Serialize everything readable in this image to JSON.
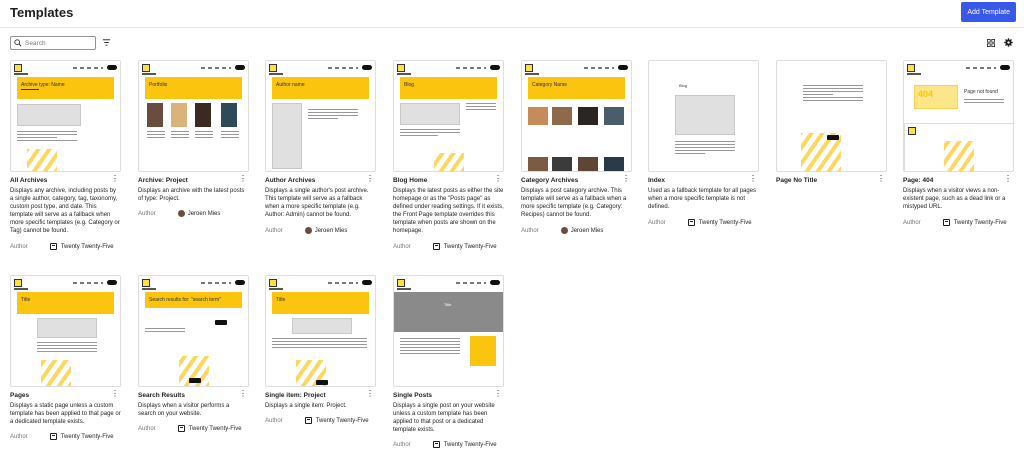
{
  "header": {
    "title": "Templates",
    "add_button": "Add Template"
  },
  "toolbar": {
    "search_placeholder": "Search"
  },
  "icons": {
    "search": "search-icon",
    "filter": "filter-icon",
    "view": "grid-view-icon",
    "settings": "gear-icon",
    "more": "more-vertical-icon",
    "theme": "layout-icon"
  },
  "colors": {
    "accent": "#3858e9",
    "theme_yellow": "#fbc40e"
  },
  "templates": [
    {
      "title": "All Archives",
      "description": "Displays any archive, including posts by a single author, category, tag, taxonomy, custom post type, and date. This template will serve as a fallback when more specific templates (e.g. Category or Tag) cannot be found.",
      "author_label": "Author",
      "author": "Twenty Twenty-Five",
      "thumb_title": "Archive type: Name"
    },
    {
      "title": "Archive: Project",
      "description": "Displays an archive with the latest posts of type: Project.",
      "author_label": "Author",
      "author": "Jeroen Mies",
      "thumb_title": "Portfolio"
    },
    {
      "title": "Author Archives",
      "description": "Displays a single author's post archive. This template will serve as a fallback when a more specific template (e.g. Author: Admin) cannot be found.",
      "author_label": "Author",
      "author": "Jeroen Mies",
      "thumb_title": "Author name"
    },
    {
      "title": "Blog Home",
      "description": "Displays the latest posts as either the site homepage or as the \"Posts page\" as defined under reading settings. If it exists, the Front Page template overrides this template when posts are shown on the homepage.",
      "author_label": "Author",
      "author": "Twenty Twenty-Five",
      "thumb_title": "Blog"
    },
    {
      "title": "Category Archives",
      "description": "Displays a post category archive. This template will serve as a fallback when a more specific template (e.g. Category: Recipes) cannot be found.",
      "author_label": "Author",
      "author": "Jeroen Mies",
      "thumb_title": "Category Name"
    },
    {
      "title": "Index",
      "description": "Used as a fallback template for all pages when a more specific template is not defined.",
      "author_label": "Author",
      "author": "Twenty Twenty-Five",
      "thumb_title": "Blog"
    },
    {
      "title": "Page No Title",
      "description": "",
      "author_label": "",
      "author": "",
      "thumb_title": ""
    },
    {
      "title": "Page: 404",
      "description": "Displays when a visitor views a non-existent page, such as a dead link or a mistyped URL.",
      "author_label": "Author",
      "author": "Twenty Twenty-Five",
      "thumb_title": "Page not found"
    },
    {
      "title": "Pages",
      "description": "Displays a static page unless a custom template has been applied to that page or a dedicated template exists.",
      "author_label": "Author",
      "author": "Twenty Twenty-Five",
      "thumb_title": "Title"
    },
    {
      "title": "Search Results",
      "description": "Displays when a visitor performs a search on your website.",
      "author_label": "Author",
      "author": "Twenty Twenty-Five",
      "thumb_title": "Search results for: \"search term\""
    },
    {
      "title": "Single item: Project",
      "description": "Displays a single item: Project.",
      "author_label": "Author",
      "author": "Twenty Twenty-Five",
      "thumb_title": "Title"
    },
    {
      "title": "Single Posts",
      "description": "Displays a single post on your website unless a custom template has been applied to that post or a dedicated template exists.",
      "author_label": "Author",
      "author": "Twenty Twenty-Five",
      "thumb_title": "Title"
    }
  ]
}
